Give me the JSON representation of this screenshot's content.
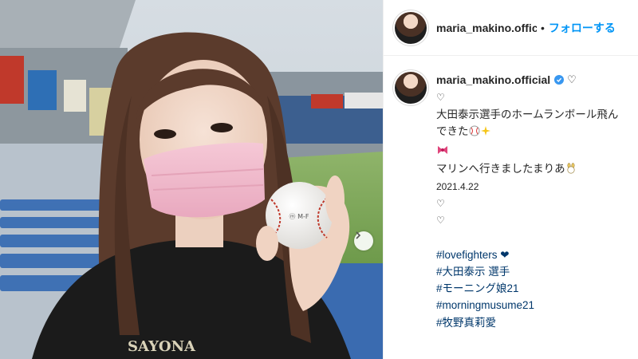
{
  "header": {
    "username": "maria_makino.offic",
    "separator": "•",
    "follow_label": "フォローする"
  },
  "caption": {
    "username": "maria_makino.official",
    "username_heart": "♡",
    "lines": [
      "♡",
      "大田泰示選手のホームランボール飛ん",
      "できた",
      "マリンへ行きましたまりあ",
      "2021.4.22",
      "♡",
      "♡",
      "",
      "#lovefighters ❤",
      "#大田泰示 選手",
      "#モーニング娘21",
      "#morningmusume21",
      "#牧野真莉愛"
    ]
  },
  "photo": {
    "shirt_text": "SAYONA",
    "ball_text": "ⓜ M-F",
    "icons": {
      "baseball": "baseball-emoji-icon",
      "sparkles": "sparkles-emoji-icon",
      "ribbon": "ribbon-emoji-icon",
      "rabbit": "rabbit-emoji-icon",
      "verified": "verified-badge-icon",
      "next": "chevron-right-icon"
    }
  },
  "colors": {
    "accent": "#0095f6",
    "hashtag": "#00376b",
    "verified": "#3897f0",
    "text": "#262626",
    "mask": "#f1bccd",
    "hair": "#5b3b2c",
    "field": "#7fa85c",
    "seats": "#2a63b0"
  }
}
